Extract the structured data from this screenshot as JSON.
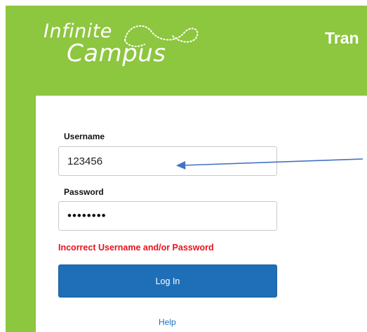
{
  "brand": {
    "name_line1": "Infinite",
    "name_line2": "Campus",
    "colors": {
      "header_bg": "#8dc63f",
      "text": "#ffffff"
    }
  },
  "header": {
    "title": "Tran"
  },
  "login": {
    "username_label": "Username",
    "username_value": "123456",
    "password_label": "Password",
    "password_value": "••••••••",
    "error_message": "Incorrect Username and/or Password",
    "submit_label": "Log In",
    "help_label": "Help",
    "colors": {
      "button": "#1e6fb8",
      "error": "#e8111c"
    }
  },
  "annotation": {
    "icon": "arrow-left-icon",
    "color": "#4472c4"
  }
}
